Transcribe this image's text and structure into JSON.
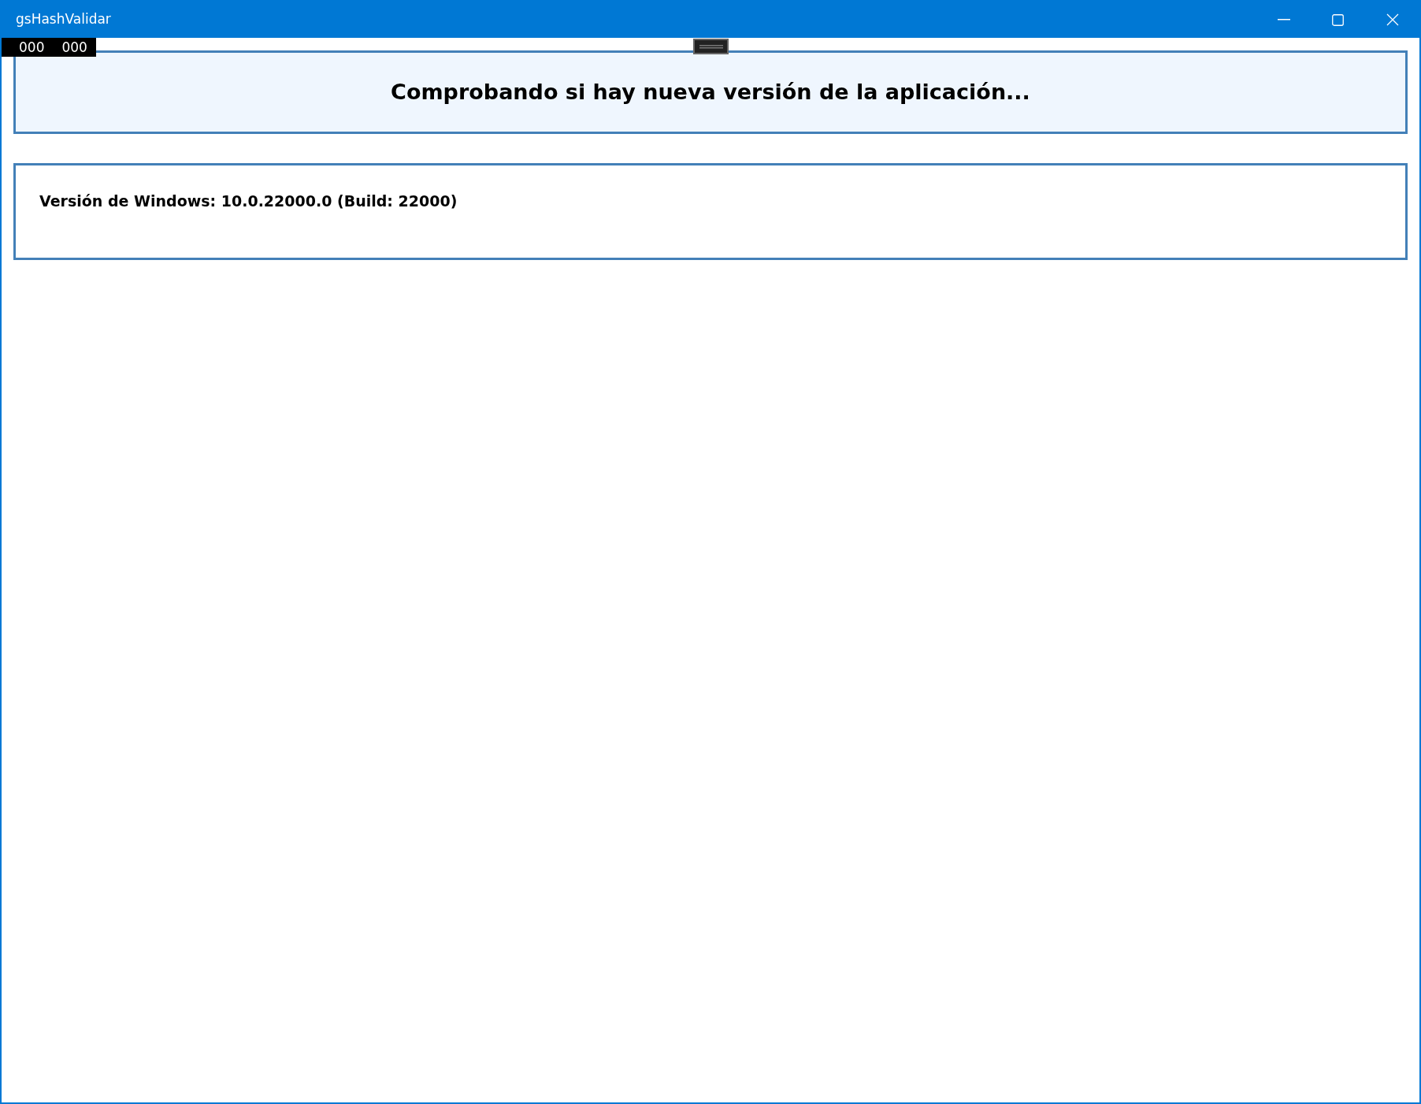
{
  "window": {
    "title": "gsHashValidar"
  },
  "frame_counter": [
    "000",
    "000"
  ],
  "status_panel": {
    "message": "Comprobando si hay nueva versión de la aplicación..."
  },
  "info_panel": {
    "windows_version": "Versión de Windows: 10.0.22000.0 (Build: 22000)"
  }
}
